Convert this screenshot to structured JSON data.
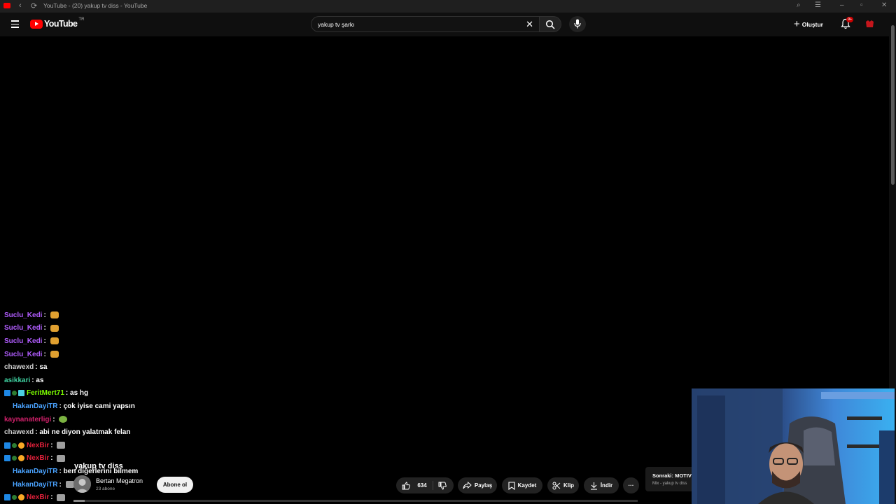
{
  "window": {
    "title": "YouTube - (20) yakup tv diss - YouTube"
  },
  "masthead": {
    "logo_text": "YouTube",
    "country_code": "TR",
    "search_value": "yakup tv şarkı",
    "create_label": "Oluştur",
    "notification_count": "9+"
  },
  "chat": [
    {
      "name": "Suclu_Kedi",
      "color": "#b15dff",
      "message": "",
      "emote": "em-hand",
      "badges": [],
      "indent": false
    },
    {
      "name": "Suclu_Kedi",
      "color": "#b15dff",
      "message": "",
      "emote": "em-hand",
      "badges": [],
      "indent": false
    },
    {
      "name": "Suclu_Kedi",
      "color": "#b15dff",
      "message": "",
      "emote": "em-hand",
      "badges": [],
      "indent": false
    },
    {
      "name": "Suclu_Kedi",
      "color": "#b15dff",
      "message": "",
      "emote": "em-hand",
      "badges": [],
      "indent": false
    },
    {
      "name": "chawexd",
      "color": "#d0d0d0",
      "message": "sa",
      "emote": "",
      "badges": [],
      "indent": false
    },
    {
      "name": "asikkari",
      "color": "#3fd0a0",
      "message": "as",
      "emote": "",
      "badges": [],
      "indent": false
    },
    {
      "name": "FeritMert71",
      "color": "#7cfc00",
      "message": "as hg",
      "emote": "",
      "badges": [
        "b-sub",
        "b-gear",
        "b-cube"
      ],
      "indent": false
    },
    {
      "name": "HakanDayiTR",
      "color": "#4aa3ff",
      "message": "çok iyise cami yapsın",
      "emote": "",
      "badges": [],
      "indent": true
    },
    {
      "name": "kaynanaterligi",
      "color": "#d0206a",
      "message": "",
      "emote": "em-ball",
      "badges": [],
      "indent": false
    },
    {
      "name": "chawexd",
      "color": "#d0d0d0",
      "message": "abi ne diyon yalatmak felan",
      "emote": "",
      "badges": [],
      "indent": false
    },
    {
      "name": "NexBir",
      "color": "#e0203a",
      "message": "",
      "emote": "em-face",
      "badges": [
        "b-sub",
        "b-gear",
        "b-coin"
      ],
      "indent": false
    },
    {
      "name": "NexBir",
      "color": "#e0203a",
      "message": "",
      "emote": "em-face",
      "badges": [
        "b-sub",
        "b-gear",
        "b-coin"
      ],
      "indent": false
    },
    {
      "name": "HakanDayiTR",
      "color": "#4aa3ff",
      "message": "ben diğerlerini bilmem",
      "emote": "",
      "badges": [],
      "indent": true
    },
    {
      "name": "HakanDayiTR",
      "color": "#4aa3ff",
      "message": "",
      "emote": "em-face",
      "badges": [],
      "indent": true
    },
    {
      "name": "NexBir",
      "color": "#e0203a",
      "message": "",
      "emote": "em-face",
      "badges": [
        "b-sub",
        "b-gear",
        "b-coin"
      ],
      "indent": false
    }
  ],
  "video": {
    "title": "yakup tv diss",
    "channel_name": "Bertan Megatron",
    "subscribers": "23 abone",
    "subscribe_label": "Abone ol",
    "like_count": "634",
    "share_label": "Paylaş",
    "save_label": "Kaydet",
    "clip_label": "Klip",
    "download_label": "İndir",
    "more_label": "···",
    "progress_fraction": 0.02
  },
  "up_next": {
    "label": "Sonraki: MOTIV",
    "sub": "Mix - yakup tv diss"
  },
  "colors": {
    "brand_red": "#ff0000",
    "background": "#000000",
    "masthead": "#0f0f0f",
    "pill": "#222222"
  }
}
